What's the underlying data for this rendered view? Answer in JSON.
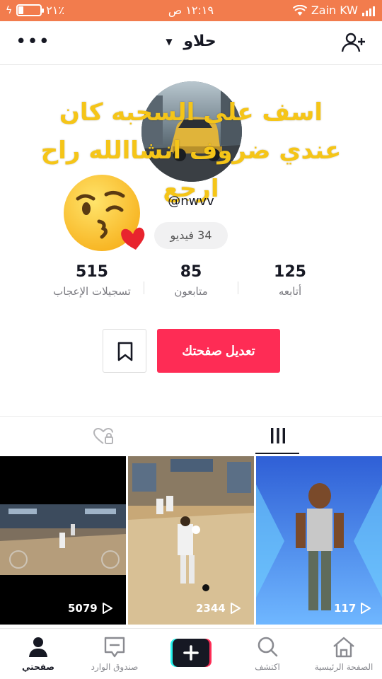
{
  "status_bar": {
    "battery_text": "٢١٪",
    "battery_level": 0.21,
    "time": "١٢:١٩ ص",
    "carrier": "Zain KW",
    "bg_color": "#f27c4d"
  },
  "header": {
    "title": "حلاو",
    "more_icon": "more-horizontal-icon",
    "add_user_icon": "add-user-icon"
  },
  "profile": {
    "username": "@nwvv",
    "overlay_text": "اسف على السحبه كان عندي ضروف انشاالله راح ارجع",
    "overlay_color": "#f5c518",
    "emoji": "kissing-face-heart-emoji",
    "videos_pill": "34 فيديو"
  },
  "stats": [
    {
      "value": "515",
      "label": "تسجيلات الإعجاب"
    },
    {
      "value": "85",
      "label": "متابعون"
    },
    {
      "value": "125",
      "label": "أتابعه"
    }
  ],
  "actions": {
    "edit_label": "تعديل صفحتك",
    "edit_color": "#fe2c55",
    "bookmark_icon": "bookmark-icon"
  },
  "tabs": [
    {
      "name": "liked-private",
      "icon": "heart-lock-icon"
    },
    {
      "name": "videos-grid",
      "icon": "grid-icon",
      "active": true
    }
  ],
  "videos": [
    {
      "views": "5079",
      "icon": "play-icon"
    },
    {
      "views": "2344",
      "icon": "play-icon"
    },
    {
      "views": "117",
      "icon": "play-icon"
    }
  ],
  "bottom_nav": [
    {
      "label": "صفحتي",
      "icon": "profile-icon",
      "active": true
    },
    {
      "label": "صندوق الوارد",
      "icon": "inbox-icon"
    },
    {
      "label": "",
      "icon": "plus-icon"
    },
    {
      "label": "اكتشف",
      "icon": "search-icon"
    },
    {
      "label": "الصفحة الرئيسية",
      "icon": "home-icon"
    }
  ]
}
